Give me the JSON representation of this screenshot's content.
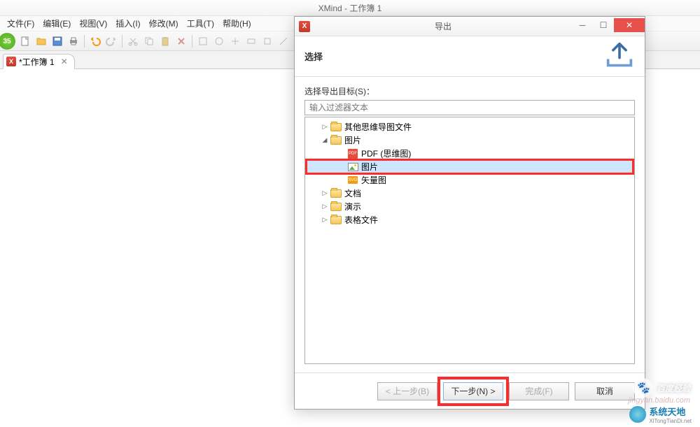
{
  "main_window": {
    "title": "XMind - 工作簿 1",
    "menus": [
      "文件(F)",
      "编辑(E)",
      "视图(V)",
      "插入(I)",
      "修改(M)",
      "工具(T)",
      "帮助(H)"
    ],
    "badge": "35",
    "tab": {
      "label": "*工作簿 1"
    }
  },
  "dialog": {
    "title": "导出",
    "banner": "选择",
    "select_label": "选择导出目标(S)：",
    "filter_placeholder": "输入过滤器文本",
    "tree": [
      {
        "label": "其他思维导图文件",
        "level": 1,
        "type": "folder",
        "expander": "▷"
      },
      {
        "label": "图片",
        "level": 1,
        "type": "folder",
        "expander": "◢"
      },
      {
        "label": "PDF (思维图)",
        "level": 2,
        "type": "pdf",
        "expander": ""
      },
      {
        "label": "图片",
        "level": 2,
        "type": "img",
        "expander": "",
        "highlighted": true
      },
      {
        "label": "矢量图",
        "level": 2,
        "type": "svg",
        "expander": ""
      },
      {
        "label": "文档",
        "level": 1,
        "type": "folder",
        "expander": "▷"
      },
      {
        "label": "演示",
        "level": 1,
        "type": "folder",
        "expander": "▷"
      },
      {
        "label": "表格文件",
        "level": 1,
        "type": "folder",
        "expander": "▷"
      }
    ],
    "buttons": {
      "back": "< 上一步(B)",
      "next": "下一步(N) >",
      "finish": "完成(F)",
      "cancel": "取消"
    }
  },
  "watermark": {
    "main": "百度经验",
    "sub": "jingyan.baidu.com"
  },
  "brand": {
    "name": "系统天地",
    "sub": "XiTongTianDi.net"
  }
}
